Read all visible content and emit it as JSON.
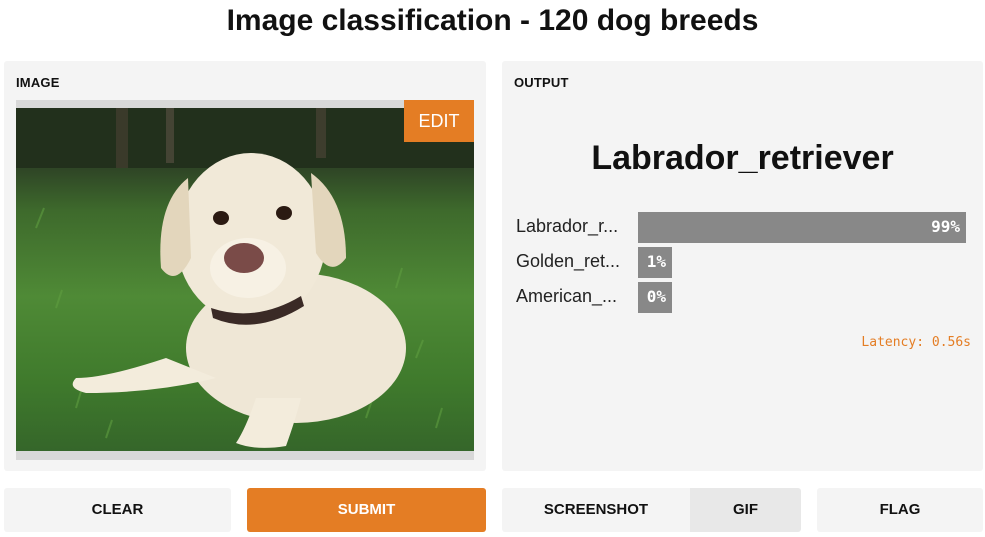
{
  "page": {
    "title": "Image classification - 120 dog breeds"
  },
  "input": {
    "label": "IMAGE",
    "edit_label": "EDIT"
  },
  "output": {
    "label": "OUTPUT",
    "prediction": "Labrador_retriever",
    "confidences": [
      {
        "label": "Labrador_r...",
        "percent_text": "99%",
        "value": 0.99
      },
      {
        "label": "Golden_ret...",
        "percent_text": "1%",
        "value": 0.01
      },
      {
        "label": "American_...",
        "percent_text": "0%",
        "value": 0.0
      }
    ],
    "latency": "Latency: 0.56s"
  },
  "buttons": {
    "clear": "CLEAR",
    "submit": "SUBMIT",
    "screenshot": "SCREENSHOT",
    "gif": "GIF",
    "flag": "FLAG"
  },
  "colors": {
    "accent": "#e47d24",
    "bar": "#888888",
    "panel": "#f4f4f4"
  }
}
